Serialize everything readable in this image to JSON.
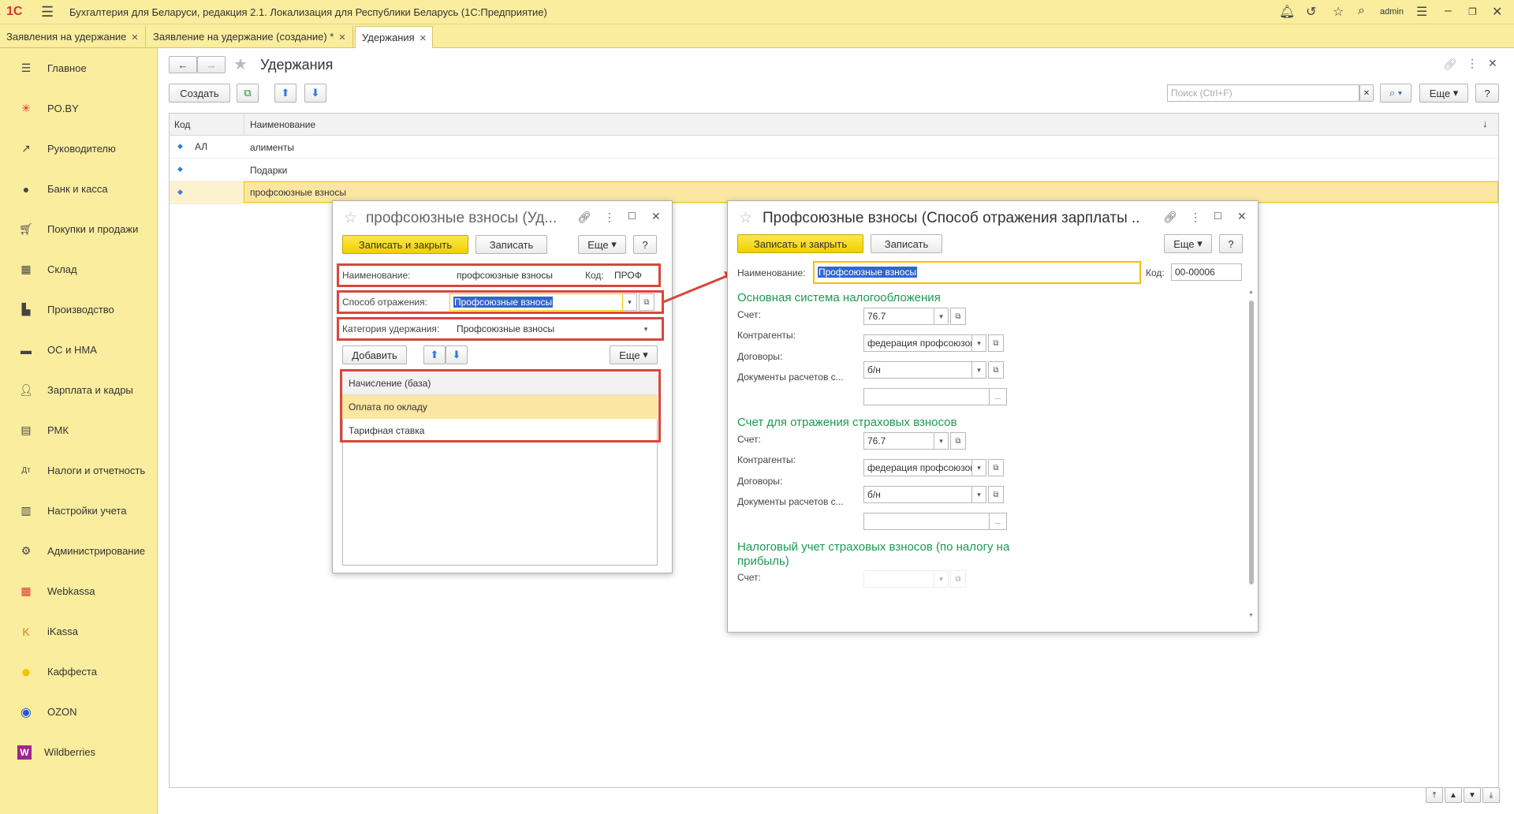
{
  "app": {
    "logo": "1С",
    "title": "Бухгалтерия для Беларуси, редакция 2.1. Локализация для Республики Беларусь   (1С:Предприятие)",
    "user": "admin"
  },
  "tabs": [
    {
      "label": "Заявления на удержание"
    },
    {
      "label": "Заявление на удержание (создание) *"
    },
    {
      "label": "Удержания"
    }
  ],
  "sidebar": {
    "items": [
      {
        "label": "Главное",
        "icon": "menu-icon"
      },
      {
        "label": "PO.BY",
        "icon": "po-by-icon"
      },
      {
        "label": "Руководителю",
        "icon": "trend-icon"
      },
      {
        "label": "Банк и касса",
        "icon": "coin-icon"
      },
      {
        "label": "Покупки и продажи",
        "icon": "cart-icon"
      },
      {
        "label": "Склад",
        "icon": "warehouse-icon"
      },
      {
        "label": "Производство",
        "icon": "factory-icon"
      },
      {
        "label": "ОС и НМА",
        "icon": "truck-icon"
      },
      {
        "label": "Зарплата и кадры",
        "icon": "person-icon"
      },
      {
        "label": "РМК",
        "icon": "cashbox-icon"
      },
      {
        "label": "Налоги и отчетность",
        "icon": "tax-icon"
      },
      {
        "label": "Настройки учета",
        "icon": "settings-doc-icon"
      },
      {
        "label": "Администрирование",
        "icon": "gear-icon"
      },
      {
        "label": "Webkassa",
        "icon": "webkassa-icon"
      },
      {
        "label": "iKassa",
        "icon": "ikassa-icon"
      },
      {
        "label": "Каффеста",
        "icon": "kaffesta-icon"
      },
      {
        "label": "OZON",
        "icon": "ozon-icon"
      },
      {
        "label": "Wildberries",
        "icon": "wildberries-icon"
      }
    ]
  },
  "list": {
    "title": "Удержания",
    "create_label": "Создать",
    "search_placeholder": "Поиск (Ctrl+F)",
    "more_label": "Еще",
    "help_label": "?",
    "columns": [
      "Код",
      "Наименование"
    ],
    "rows": [
      {
        "code": "АЛ",
        "name": "алименты"
      },
      {
        "code": "",
        "name": "Подарки"
      },
      {
        "code": "",
        "name": "профсоюзные взносы"
      }
    ]
  },
  "dialog1": {
    "title": "профсоюзные взносы (Уд...",
    "save_close_label": "Записать и закрыть",
    "save_label": "Записать",
    "more_label": "Еще",
    "help_label": "?",
    "name_label": "Наименование:",
    "name_value": "профсоюзные взносы",
    "code_label": "Код:",
    "code_value": "ПРОФ",
    "method_label": "Способ отражения:",
    "method_value": "Профсоюзные взносы",
    "category_label": "Категория удержания:",
    "category_value": "Профсоюзные взносы",
    "add_label": "Добавить",
    "table_header": "Начисление (база)",
    "table_rows": [
      "Оплата по окладу",
      "Тарифная ставка"
    ]
  },
  "dialog2": {
    "title": "Профсоюзные взносы (Способ отражения зарплаты ...",
    "save_close_label": "Записать и закрыть",
    "save_label": "Записать",
    "more_label": "Еще",
    "help_label": "?",
    "name_label": "Наименование:",
    "name_value": "Профсоюзные взносы",
    "code_label": "Код:",
    "code_value": "00-00006",
    "section1": "Основная система налогообложения",
    "section2": "Счет для отражения страховых взносов",
    "section3": "Налоговый учет страховых взносов (по налогу на прибыль)",
    "account_label": "Счет:",
    "counterparty_label": "Контрагенты:",
    "contracts_label": "Договоры:",
    "docs_label": "Документы расчетов с...",
    "account1": "76.7",
    "counterparty1": "федерация профсоюзов",
    "contracts1": "б/н",
    "account2": "76.7",
    "counterparty2": "федерация профсоюзов",
    "contracts2": "б/н",
    "account3": "",
    "ellipsis": "..."
  },
  "colors": {
    "accent_yellow": "#fbed9e",
    "highlight_border": "#d9473a",
    "section_green": "#1a9a52",
    "selection_blue": "#3266cc"
  }
}
